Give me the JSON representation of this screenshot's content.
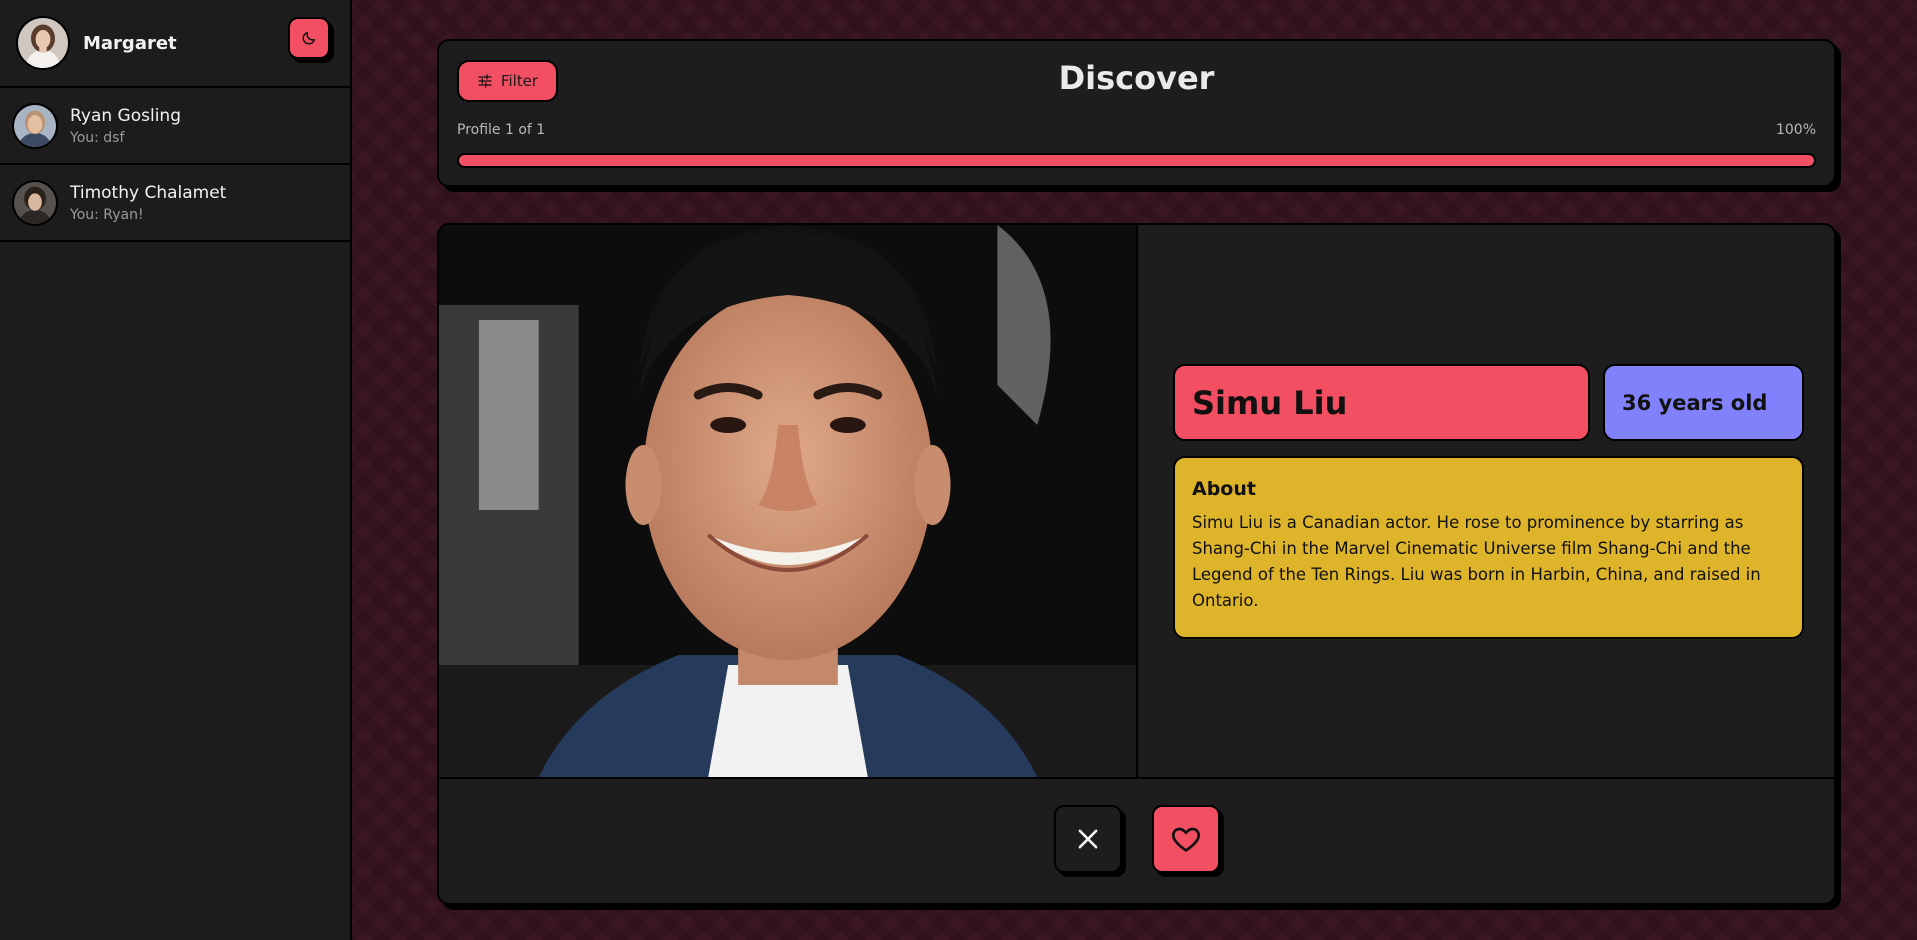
{
  "sidebar": {
    "user": {
      "name": "Margaret",
      "avatar_icon": "user-avatar"
    },
    "theme_toggle_icon": "moon-icon",
    "chats": [
      {
        "name": "Ryan Gosling",
        "preview": "You: dsf"
      },
      {
        "name": "Timothy Chalamet",
        "preview": "You: Ryan!"
      }
    ]
  },
  "header": {
    "filter_label": "Filter",
    "filter_icon": "sliders-icon",
    "title": "Discover",
    "progress_label": "Profile 1 of 1",
    "progress_percent_label": "100%",
    "progress_value": 1.0
  },
  "profile": {
    "name": "Simu Liu",
    "age": "36 years old",
    "about_title": "About",
    "about_text": "Simu Liu is a Canadian actor. He rose to prominence by starring as Shang-Chi in the Marvel Cinematic Universe film Shang-Chi and the Legend of the Ten Rings. Liu was born in Harbin, China, and raised in Ontario."
  },
  "actions": {
    "reject_icon": "close-icon",
    "like_icon": "heart-icon"
  },
  "colors": {
    "accent": "#f24f63",
    "age_badge": "#8182fb",
    "about_box": "#deb42b",
    "panel": "#1d1d1d",
    "background": "#3b1625"
  }
}
